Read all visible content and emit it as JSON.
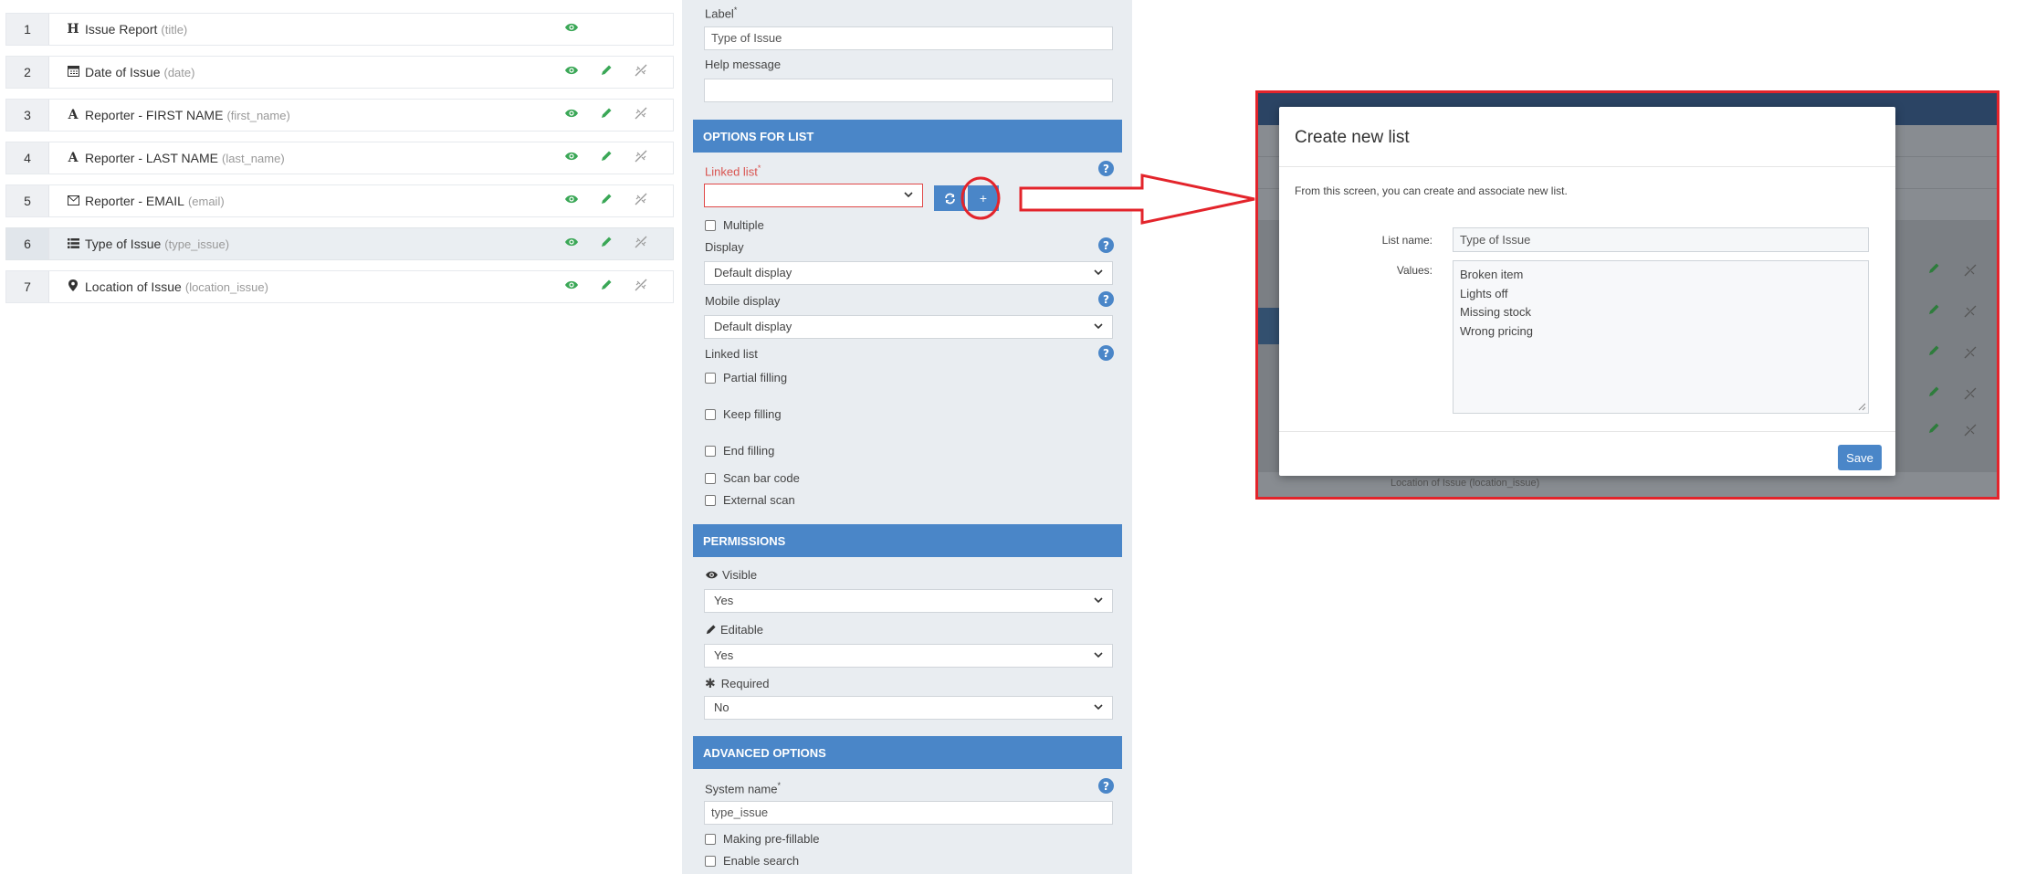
{
  "fields": [
    {
      "num": "1",
      "label": "Issue Report",
      "system": "(title)",
      "type_icon": "heading-icon"
    },
    {
      "num": "2",
      "label": "Date of Issue",
      "system": "(date)",
      "type_icon": "calendar-icon"
    },
    {
      "num": "3",
      "label": "Reporter - FIRST NAME",
      "system": "(first_name)",
      "type_icon": "font-icon"
    },
    {
      "num": "4",
      "label": "Reporter - LAST NAME",
      "system": "(last_name)",
      "type_icon": "font-icon"
    },
    {
      "num": "5",
      "label": "Reporter - EMAIL",
      "system": "(email)",
      "type_icon": "envelope-icon"
    },
    {
      "num": "6",
      "label": "Type of Issue",
      "system": "(type_issue)",
      "type_icon": "list-icon"
    },
    {
      "num": "7",
      "label": "Location of Issue",
      "system": "(location_issue)",
      "type_icon": "map-marker-icon"
    }
  ],
  "panel": {
    "label_title": "Label",
    "label_required_mark": "*",
    "label_value": "Type of Issue",
    "help_title": "Help message",
    "help_value": "",
    "options_header": "OPTIONS FOR LIST",
    "linked_list_label": "Linked list",
    "linked_list_required_mark": "*",
    "linked_list_value": "",
    "add_button_label": "+",
    "multiple_label": "Multiple",
    "display_label": "Display",
    "display_value": "Default display",
    "mobile_display_label": "Mobile display",
    "mobile_display_value": "Default display",
    "linked_list_section_label": "Linked list",
    "partial_filling_label": "Partial filling",
    "keep_filling_label": "Keep filling",
    "end_filling_label": "End filling",
    "scan_bar_code_label": "Scan bar code",
    "external_scan_label": "External scan",
    "permissions_header": "PERMISSIONS",
    "visible_label": "Visible",
    "visible_value": "Yes",
    "editable_label": "Editable",
    "editable_value": "Yes",
    "required_label": "Required",
    "required_value": "No",
    "advanced_header": "ADVANCED OPTIONS",
    "system_name_label": "System name",
    "system_name_required_mark": "*",
    "system_name_value": "type_issue",
    "prefillable_label": "Making pre-fillable",
    "enable_search_label": "Enable search"
  },
  "modal": {
    "title": "Create new list",
    "description": "From this screen, you can create and associate new list.",
    "list_name_label": "List name:",
    "list_name_value": "Type of Issue",
    "values_label": "Values:",
    "values": [
      "Broken item",
      "Lights off",
      "Missing stock",
      "Wrong pricing"
    ],
    "save_label": "Save",
    "background_footer_text": "Location of Issue (location_issue)"
  },
  "colors": {
    "accent_blue": "#4a86c8",
    "action_green": "#3aa756",
    "highlight_red": "#e3242b",
    "required_red": "#d9534f"
  }
}
